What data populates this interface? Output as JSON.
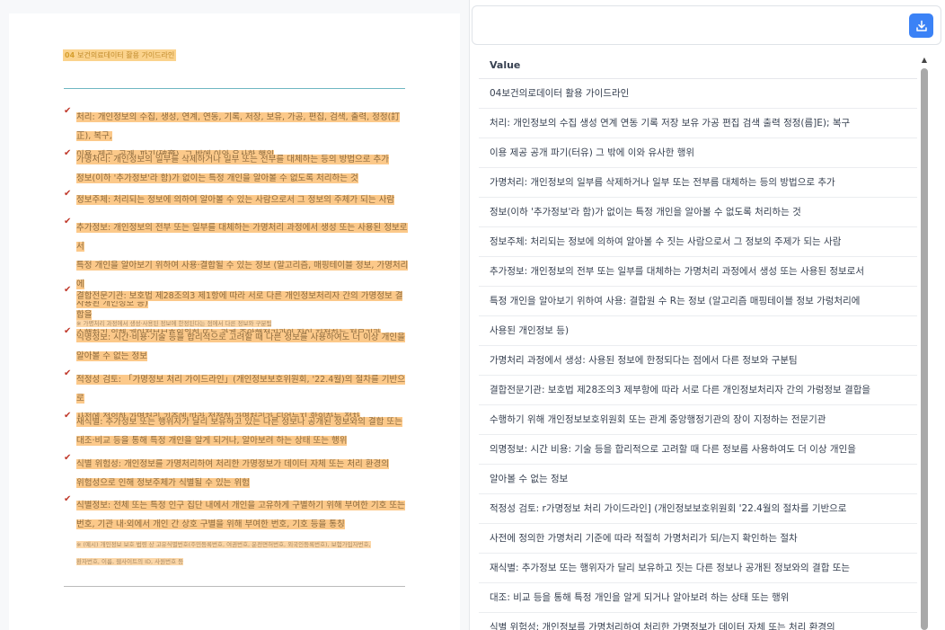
{
  "document": {
    "header_num": "04",
    "header_text": "보건의료데이터 활용 가이드라인",
    "items": [
      {
        "lines": [
          "처리: 개인정보의 수집, 생성, 연계, 연동, 기록, 저장, 보유, 가공, 편집, 검색, 출력, 정정(訂正), 복구,",
          "이용, 제공, 공개, 파기(破棄), 그 밖에 이와 유사한 행위"
        ]
      },
      {
        "lines": [
          "가명처리: 개인정보의 일부를 삭제하거나 일부 또는 전부를 대체하는 등의 방법으로 추가",
          "정보(이하 '추가정보'라 함)가 없이는 특정 개인을 알아볼 수 없도록 처리하는 것"
        ]
      },
      {
        "lines": [
          "정보주체: 처리되는 정보에 의하여 알아볼 수 있는 사람으로서 그 정보의 주체가 되는 사람"
        ]
      },
      {
        "lines": [
          "추가정보: 개인정보의 전부 또는 일부를 대체하는 가명처리 과정에서 생성 또는 사용된 정보로서",
          "특정 개인을 알아보기 위하여 사용·결합될 수 있는 정보 (알고리즘, 매핑테이블 정보, 가명처리에",
          "사용된 개인정보 등)"
        ],
        "note": [
          "※ 가명처리 과정에서 생성·사용된 정보에 한정된다는 점에서 다른 정보와 구분됨"
        ]
      },
      {
        "lines": [
          "결합전문기관: 보호법 제28조의3 제1항에 따라 서로 다른 개인정보처리자 간의 가명정보 결합을",
          "수행하기 위해 개인정보보호위원회 또는 관계 중앙행정기관의 장이 지정하는 전문기관"
        ]
      },
      {
        "lines": [
          "익명정보: 시간·비용·기술 등을 합리적으로 고려할 때 다른 정보를 사용하여도 더 이상 개인을",
          "알아볼 수 없는 정보"
        ]
      },
      {
        "lines": [
          "적정성 검토: 「가명정보 처리 가이드라인」(개인정보보호위원회, '22.4월)의 절차를 기반으로",
          "사전에 정의한 가명처리 기준에 따라 적절히 가명처리가 되었는지 확인하는 절차"
        ]
      },
      {
        "lines": [
          "재식별: 추가정보 또는 행위자가 달리 보유하고 있는 다른 정보나 공개된 정보와의 결합 또는",
          "대조·비교 등을 통해 특정 개인을 알게 되거나, 알아보려 하는 상태 또는 행위"
        ]
      },
      {
        "lines": [
          "식별 위험성: 개인정보를 가명처리하여 처리한 가명정보가 데이터 자체 또는 처리 환경의",
          "위험성으로 인해 정보주체가 식별될 수 있는 위험"
        ]
      },
      {
        "lines": [
          "식별정보: 전체 또는 특정 인구 집단 내에서 개인을 고유하게 구별하기 위해 부여한 기호 또는",
          "번호, 기관 내·외에서 개인 간 상호 구별을 위해 부여한 번호, 기호 등을 통칭"
        ],
        "note": [
          "※ (예시) 개인정보 보호 법령 상 고유식별번호(주민등록번호, 여권번호, 운전면허번호, 외국인등록번호), 보험가입자번호,",
          "환자번호, 이름, 웹사이트의 ID, 사원번호 등"
        ]
      }
    ]
  },
  "table": {
    "column_header": "Value",
    "rows": [
      "04보건의로데이터 활용 가이드라인",
      "처리: 개인정보의 수집 생성 연계 연동 기록 저장 보유 가공 편집 검색 출력 정정(름]E); 복구",
      "이용 제공 공개 파기(터유) 그 밖에 이와 유사한 행위",
      "가명처리: 개인정보의 일부름 삭제하거나 일부 또는 전부름 대체하는 등의 방법으로 추가",
      "정보(이하 '추가정보'라 함)가 없이는 특정 개인을 알아볼 수 없도록 처리하는 것",
      "정보주체: 처리되는 정보에 의하여 알아볼 수 짓는 사람으로서 그 정보의 주제가 되는 사람",
      "추가정보: 개인정보의 전부 또는 일부를 대체하는 가명처리 과정에서 생성 또는 사용된 정보로서",
      "특정 개인을 알아보기 위하여 사용: 결합원 수 R는 정보 (알고리즘 매핑테이블 정보 가렁처리에",
      "사용된 개인정보 등)",
      "가명처리 과정에서 생성: 사용된 정보에 한정되다는 점에서 다른 정보와 구분팀",
      "결합전문기관: 보호법 제28조의3 제부항에 따라 서로 다른 개인정보처리자 간의 가렁정보 결합을",
      "수행하기 위해 개인정보보호위원회 또는 관계 중앙행정기관의 장이 지정하는 전문기관",
      "의명정보: 시간 비용: 기술 등을 합리적으로 고려할 때 다른 정보름 사용하여도 더 이상 개인을",
      "알아볼 수 없는 정보",
      "적정성 검토: r가명정보 처리 가이드라인] (개인정보보호위원회 '22.4월의 절차를 기반으로",
      "사전에 정의한 가명처리 기준에 따라 적절히 가명처리가 되/는지 확인하는 절차",
      "재식별: 추가정보 또는 행위자가 달리 보유하고 짓는 다른 정보나 공개된 정보와의 결합 또는",
      "대조: 비교 등을 통해 특정 개인을 알게 되거나 알아보려 하는 상태 또는 행위",
      "식별 위험성: 개인정보를 가명처리하여 처리한 가명정보가 데이터 자체 또는 처리 환경의"
    ]
  },
  "icons": {
    "download": "download-icon",
    "check": "checkmark-icon",
    "scroll_up": "scroll-up-arrow-icon"
  },
  "colors": {
    "highlight": "#fcc98a",
    "accent": "#3b82f6",
    "rule": "#6fb7c2"
  }
}
